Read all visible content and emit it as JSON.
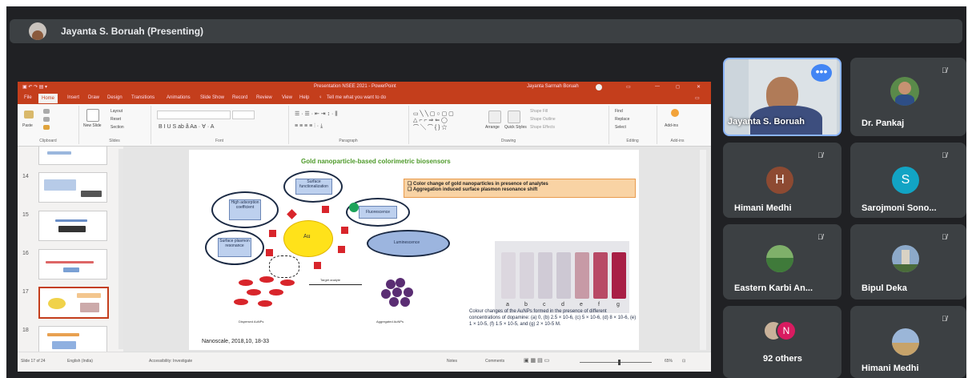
{
  "presenter": {
    "name": "Jayanta S. Boruah (Presenting)"
  },
  "powerpoint": {
    "window_title": "Presentation NSEE 2021 - PowerPoint",
    "user": "Jayanta Sarmah Boruah",
    "tabs": [
      "File",
      "Home",
      "Insert",
      "Draw",
      "Design",
      "Transitions",
      "Animations",
      "Slide Show",
      "Record",
      "Review",
      "View",
      "Help"
    ],
    "tell_me": "Tell me what you want to do",
    "ribbon_groups": [
      "Clipboard",
      "Slides",
      "Font",
      "Paragraph",
      "Drawing",
      "Editing",
      "Add-ins"
    ],
    "ribbon_buttons": {
      "paste": "Paste",
      "new_slide": "New Slide",
      "layout": "Layout",
      "reset": "Reset",
      "section": "Section",
      "arrange": "Arrange",
      "quick_styles": "Quick Styles",
      "shape_fill": "Shape Fill",
      "shape_outline": "Shape Outline",
      "shape_effects": "Shape Effects",
      "find": "Find",
      "replace": "Replace",
      "select": "Select",
      "add_ins": "Add-ins"
    },
    "slide_numbers": [
      "14",
      "15",
      "16",
      "17",
      "18"
    ],
    "status": {
      "slide": "Slide 17 of 24",
      "language": "English (India)",
      "accessibility": "Accessibility: Investigate",
      "notes": "Notes",
      "comments": "Comments",
      "zoom": "65%"
    }
  },
  "slide": {
    "title": "Gold nanoparticle-based colorimetric biosensors",
    "bullets": [
      "Color change of gold nanoparticles in presence of analytes",
      "Aggregation induced surface plasmon resonance shift"
    ],
    "labels": {
      "surface_functionalization": "Surface functionalization",
      "high_absorption": "High adsorption coefficient",
      "fluorescence": "Fluorescence",
      "luminescence": "Luminescence",
      "spr": "Surface plasmon resonance",
      "au": "Au",
      "target_analyte": "Target analyte",
      "dispersed": "Dispersed AuNPs",
      "aggregated": "Aggregated AuNPs"
    },
    "vial_labels": [
      "a",
      "b",
      "c",
      "d",
      "e",
      "f",
      "g"
    ],
    "caption": "Colour changes of the AuNPs formed in the presence of different concentrations of dopamine: (a) 0, (b) 2.5 × 10-6, (c) 5 × 10-6, (d) 8 × 10-6, (e) 1 × 10-5, (f) 1.5 × 10-5, and (g) 2 × 10-5 M.",
    "citation": "Nanoscale, 2018,10, 18-33"
  },
  "participants": [
    {
      "name": "Jayanta S. Boruah",
      "type": "video",
      "active": true
    },
    {
      "name": "Dr. Pankaj",
      "type": "photo",
      "muted": true
    },
    {
      "name": "Himani Medhi",
      "type": "initial",
      "initial": "H",
      "color": "#8d4a32",
      "muted": true
    },
    {
      "name": "Sarojmoni Sono...",
      "type": "initial",
      "initial": "S",
      "color": "#12a4c4",
      "muted": true
    },
    {
      "name": "Eastern Karbi An...",
      "type": "photo",
      "muted": true
    },
    {
      "name": "Bipul Deka",
      "type": "photo",
      "muted": true
    },
    {
      "name": "92 others",
      "type": "others",
      "initial": "N"
    },
    {
      "name": "Himani Medhi",
      "type": "photo",
      "muted": true
    }
  ],
  "colors": {
    "meet_bg": "#202124",
    "tile_bg": "#3c4043",
    "active_border": "#8ab4f8",
    "ppt_accent": "#c43e1c"
  }
}
